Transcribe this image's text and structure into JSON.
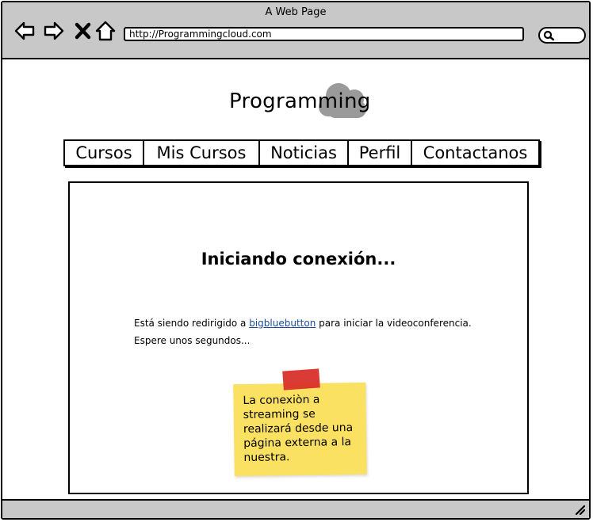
{
  "window": {
    "title": "A Web Page",
    "url": "http://Programmingcloud.com"
  },
  "logo": {
    "text": "Programming"
  },
  "nav": {
    "items": [
      {
        "label": "Cursos"
      },
      {
        "label": "Mis Cursos"
      },
      {
        "label": "Noticias"
      },
      {
        "label": "Perfil"
      },
      {
        "label": "Contactanos"
      }
    ]
  },
  "main": {
    "heading": "Iniciando conexión...",
    "line1_before": "Está siendo redirigido a ",
    "link": "bigbluebutton",
    "line1_after": " para iniciar la videoconferencia.",
    "line2": "Espere unos segundos...",
    "note": "La conexiòn a streaming se realizará desde una página externa a la nuestra."
  },
  "colors": {
    "chrome": "#c8c8c8",
    "sticky": "#fbe161",
    "tape": "#d9302a",
    "link": "#1a4a9a",
    "cloud": "#9a9a9a"
  }
}
